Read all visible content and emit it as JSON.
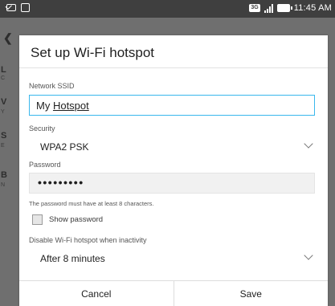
{
  "status_bar": {
    "network_badge": "3G",
    "time": "11:45 AM"
  },
  "background": {
    "letters": [
      "L",
      "V",
      "S",
      "B"
    ],
    "sub_letters": [
      "C",
      "Y",
      "E",
      "N"
    ]
  },
  "dialog": {
    "title": "Set up Wi-Fi hotspot",
    "ssid": {
      "label": "Network SSID",
      "value_prefix": "My ",
      "value_underlined": "Hotspot"
    },
    "security": {
      "label": "Security",
      "value": "WPA2 PSK"
    },
    "password": {
      "label": "Password",
      "value": "•••••••••",
      "hint": "The password must have at least 8 characters."
    },
    "show_password": {
      "label": "Show password",
      "checked": false
    },
    "inactivity": {
      "label": "Disable Wi-Fi hotspot when inactivity",
      "value": "After 8 minutes"
    },
    "buttons": {
      "cancel": "Cancel",
      "save": "Save"
    }
  },
  "colors": {
    "accent": "#39b7ec",
    "status_bar": "#3f3f3f",
    "scrim": "#6f6f6f"
  }
}
